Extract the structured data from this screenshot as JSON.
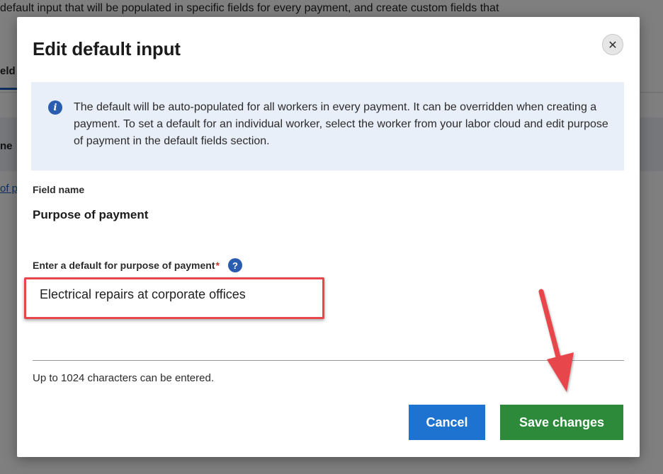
{
  "background": {
    "intro_text": "default input that will be populated in specific fields for every payment, and create custom fields that",
    "tab_label": "eld",
    "section_head": "ne",
    "link_text": "of p"
  },
  "modal": {
    "title": "Edit default input",
    "close_icon": "close-icon",
    "info": {
      "icon": "info-icon",
      "text": "The default will be auto-populated for all workers in every payment. It can be overridden when creating a payment. To set a default for an individual worker, select the worker from your labor cloud and edit purpose of payment in the default fields section."
    },
    "field_name_label": "Field name",
    "field_name_value": "Purpose of payment",
    "input": {
      "label": "Enter a default for purpose of payment",
      "required_marker": "*",
      "help_icon": "question-icon",
      "value": "Electrical repairs at corporate offices"
    },
    "char_hint": "Up to 1024 characters can be entered.",
    "buttons": {
      "cancel": "Cancel",
      "save": "Save changes"
    }
  },
  "colors": {
    "primary_blue": "#1f73d0",
    "save_green": "#2c8a3a",
    "annotation_red": "#e7474c",
    "info_bg": "#e9eff9"
  }
}
